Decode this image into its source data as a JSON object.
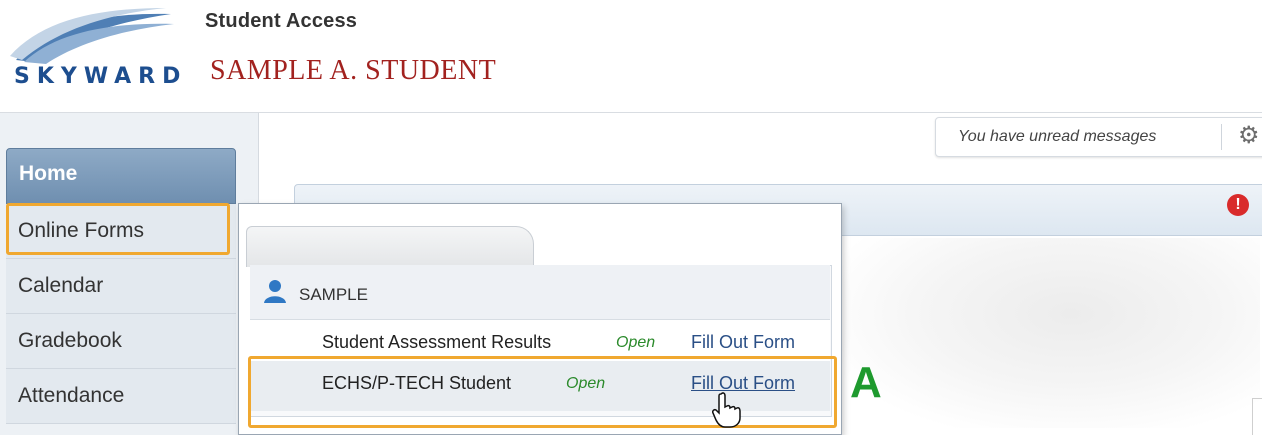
{
  "header": {
    "brand": "SKYWARD",
    "app_title": "Student Access",
    "student_name": "SAMPLE A. STUDENT"
  },
  "sidebar": {
    "items": [
      {
        "label": "Home",
        "active": true
      },
      {
        "label": "Online Forms",
        "highlighted": true
      },
      {
        "label": "Calendar"
      },
      {
        "label": "Gradebook"
      },
      {
        "label": "Attendance"
      }
    ]
  },
  "topbar": {
    "messages_text": "You have unread messages",
    "settings_icon": "gear-icon"
  },
  "alert": {
    "glyph": "!"
  },
  "popup": {
    "section_title": "SAMPLE",
    "forms": [
      {
        "name": "Student Assessment Results",
        "status": "Open",
        "action": "Fill Out Form"
      },
      {
        "name": "ECHS/P-TECH Student",
        "status": "Open",
        "action": "Fill Out Form"
      }
    ]
  },
  "annotation": {
    "label": "A"
  },
  "colors": {
    "highlight": "#f0a830",
    "brand_blue": "#1d4e8f",
    "name_red": "#a2221f",
    "status_green": "#2b8a2b",
    "callout_green": "#1e9a2e"
  }
}
